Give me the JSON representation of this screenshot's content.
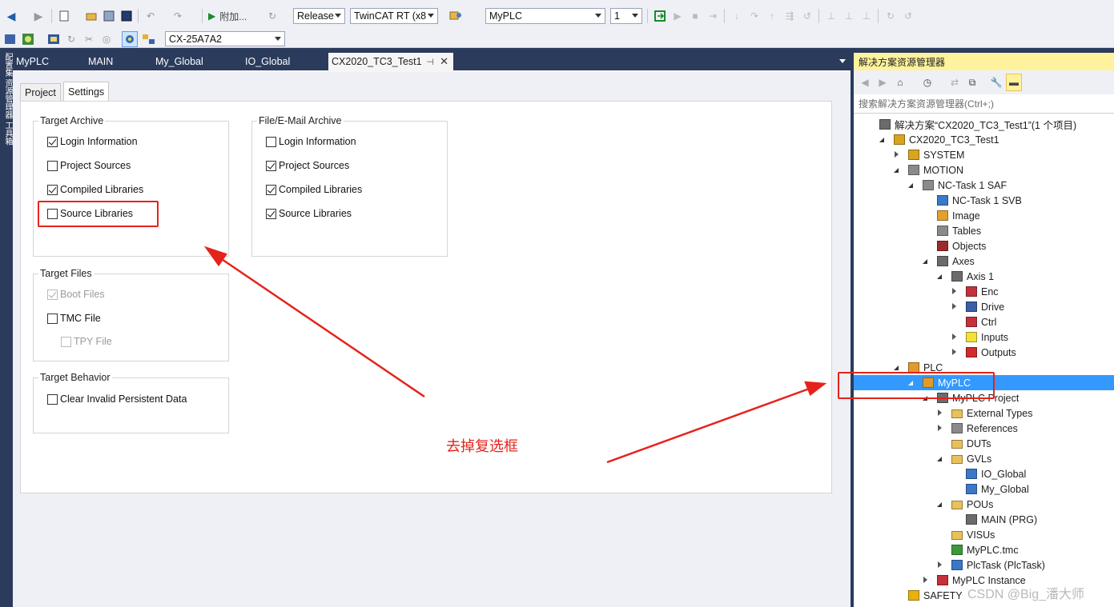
{
  "toolbar": {
    "attach_label": "附加...",
    "config_value": "Release",
    "platform_value": "TwinCAT RT (x8",
    "project_value": "MyPLC",
    "instance_value": "1",
    "target_value": "CX-25A7A2"
  },
  "left_tool": {
    "label": "配置集 资源管理器 工具箱"
  },
  "tabs": [
    {
      "label": "MyPLC"
    },
    {
      "label": "MAIN"
    },
    {
      "label": "My_Global"
    },
    {
      "label": "IO_Global"
    },
    {
      "label": "CX2020_TC3_Test1"
    }
  ],
  "settings": {
    "tabs": [
      {
        "label": "Project"
      },
      {
        "label": "Settings"
      }
    ],
    "target_archive": {
      "title": "Target Archive",
      "items": [
        {
          "label": "Login Information",
          "checked": true
        },
        {
          "label": "Project Sources",
          "checked": false
        },
        {
          "label": "Compiled Libraries",
          "checked": true
        },
        {
          "label": "Source Libraries",
          "checked": false
        }
      ]
    },
    "file_archive": {
      "title": "File/E-Mail Archive",
      "items": [
        {
          "label": "Login Information",
          "checked": false
        },
        {
          "label": "Project Sources",
          "checked": true
        },
        {
          "label": "Compiled Libraries",
          "checked": true
        },
        {
          "label": "Source Libraries",
          "checked": true
        }
      ]
    },
    "target_files": {
      "title": "Target Files",
      "items": [
        {
          "label": "Boot Files",
          "checked": true,
          "disabled": true
        },
        {
          "label": "TMC File",
          "checked": false
        },
        {
          "label": "TPY File",
          "checked": false,
          "disabled": true
        }
      ]
    },
    "target_behavior": {
      "title": "Target Behavior",
      "items": [
        {
          "label": "Clear Invalid Persistent Data",
          "checked": false
        }
      ]
    }
  },
  "annotation": {
    "text": "去掉复选框",
    "color": "#e5231b"
  },
  "solution": {
    "title": "解决方案资源管理器",
    "search_placeholder": "搜索解决方案资源管理器(Ctrl+;)",
    "nodes": [
      {
        "label": "解决方案“CX2020_TC3_Test1”(1 个项目)",
        "icon": "solution-icon"
      },
      {
        "label": "CX2020_TC3_Test1",
        "icon": "project-icon"
      },
      {
        "label": "SYSTEM",
        "icon": "system-icon"
      },
      {
        "label": "MOTION",
        "icon": "motion-icon"
      },
      {
        "label": "NC-Task 1 SAF",
        "icon": "nc-task-icon"
      },
      {
        "label": "NC-Task 1 SVB",
        "icon": "nc-svb-icon"
      },
      {
        "label": "Image",
        "icon": "image-icon"
      },
      {
        "label": "Tables",
        "icon": "table-icon"
      },
      {
        "label": "Objects",
        "icon": "objects-icon"
      },
      {
        "label": "Axes",
        "icon": "axes-icon"
      },
      {
        "label": "Axis 1",
        "icon": "axis-icon"
      },
      {
        "label": "Enc",
        "icon": "enc-icon"
      },
      {
        "label": "Drive",
        "icon": "drive-icon"
      },
      {
        "label": "Ctrl",
        "icon": "ctrl-icon"
      },
      {
        "label": "Inputs",
        "icon": "inputs-icon"
      },
      {
        "label": "Outputs",
        "icon": "outputs-icon"
      },
      {
        "label": "PLC",
        "icon": "plc-icon"
      },
      {
        "label": "MyPLC",
        "icon": "plc-project-icon"
      },
      {
        "label": "MyPLC Project",
        "icon": "plc-sub-icon"
      },
      {
        "label": "External Types",
        "icon": "folder-icon"
      },
      {
        "label": "References",
        "icon": "references-icon"
      },
      {
        "label": "DUTs",
        "icon": "folder-icon"
      },
      {
        "label": "GVLs",
        "icon": "folder-open-icon"
      },
      {
        "label": "IO_Global",
        "icon": "gvl-icon"
      },
      {
        "label": "My_Global",
        "icon": "gvl-icon"
      },
      {
        "label": "POUs",
        "icon": "folder-open-icon"
      },
      {
        "label": "MAIN (PRG)",
        "icon": "pou-icon"
      },
      {
        "label": "VISUs",
        "icon": "folder-icon"
      },
      {
        "label": "MyPLC.tmc",
        "icon": "tmc-icon"
      },
      {
        "label": "PlcTask (PlcTask)",
        "icon": "task-icon"
      },
      {
        "label": "MyPLC Instance",
        "icon": "instance-icon"
      },
      {
        "label": "SAFETY",
        "icon": "safety-icon"
      }
    ]
  },
  "watermark": "CSDN @Big_潘大师"
}
